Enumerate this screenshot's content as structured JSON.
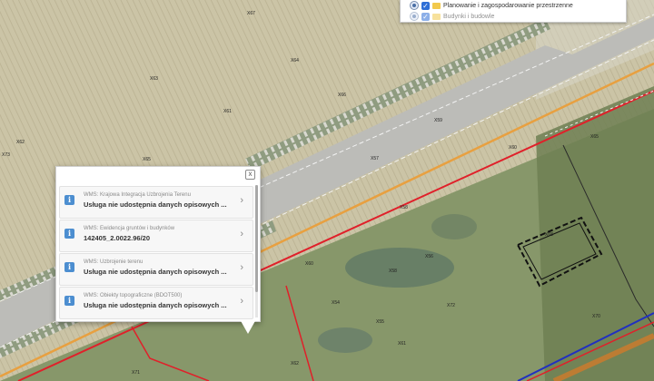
{
  "layers": [
    {
      "label": "Planowanie i zagospodarowanie przestrzenne"
    },
    {
      "label": "Budynki i budowle"
    }
  ],
  "popup": {
    "close_symbol": "x",
    "items": [
      {
        "source": "WMS: Krajowa Integracja Uzbrojenia Terenu",
        "value": "Usługa nie udostępnia danych opisowych ..."
      },
      {
        "source": "WMS: Ewidencja gruntów i budynków",
        "value": "142405_2.0022.96/20"
      },
      {
        "source": "WMS: Uzbrojenie terenu",
        "value": "Usługa nie udostępnia danych opisowych ..."
      },
      {
        "source": "WMS: Obiekty topograficzne (BDOT500)",
        "value": "Usługa nie udostępnia danych opisowych ..."
      }
    ]
  },
  "map": {
    "colors": {
      "field": "#c9c2a4",
      "road": "#b6b6b2",
      "grass": "#7c8e62",
      "parcel_line": "#e0202a",
      "utility_line": "#e8a040",
      "boundary_blue": "#2030c0"
    },
    "point_labels": [
      "X67",
      "X64",
      "X63",
      "X61",
      "X62",
      "X65",
      "X66",
      "X57",
      "X59",
      "X58",
      "X60",
      "X58",
      "X56",
      "X54",
      "X55",
      "X61",
      "X62",
      "X60",
      "X65",
      "X68",
      "X70",
      "X71",
      "X72",
      "X73"
    ]
  }
}
